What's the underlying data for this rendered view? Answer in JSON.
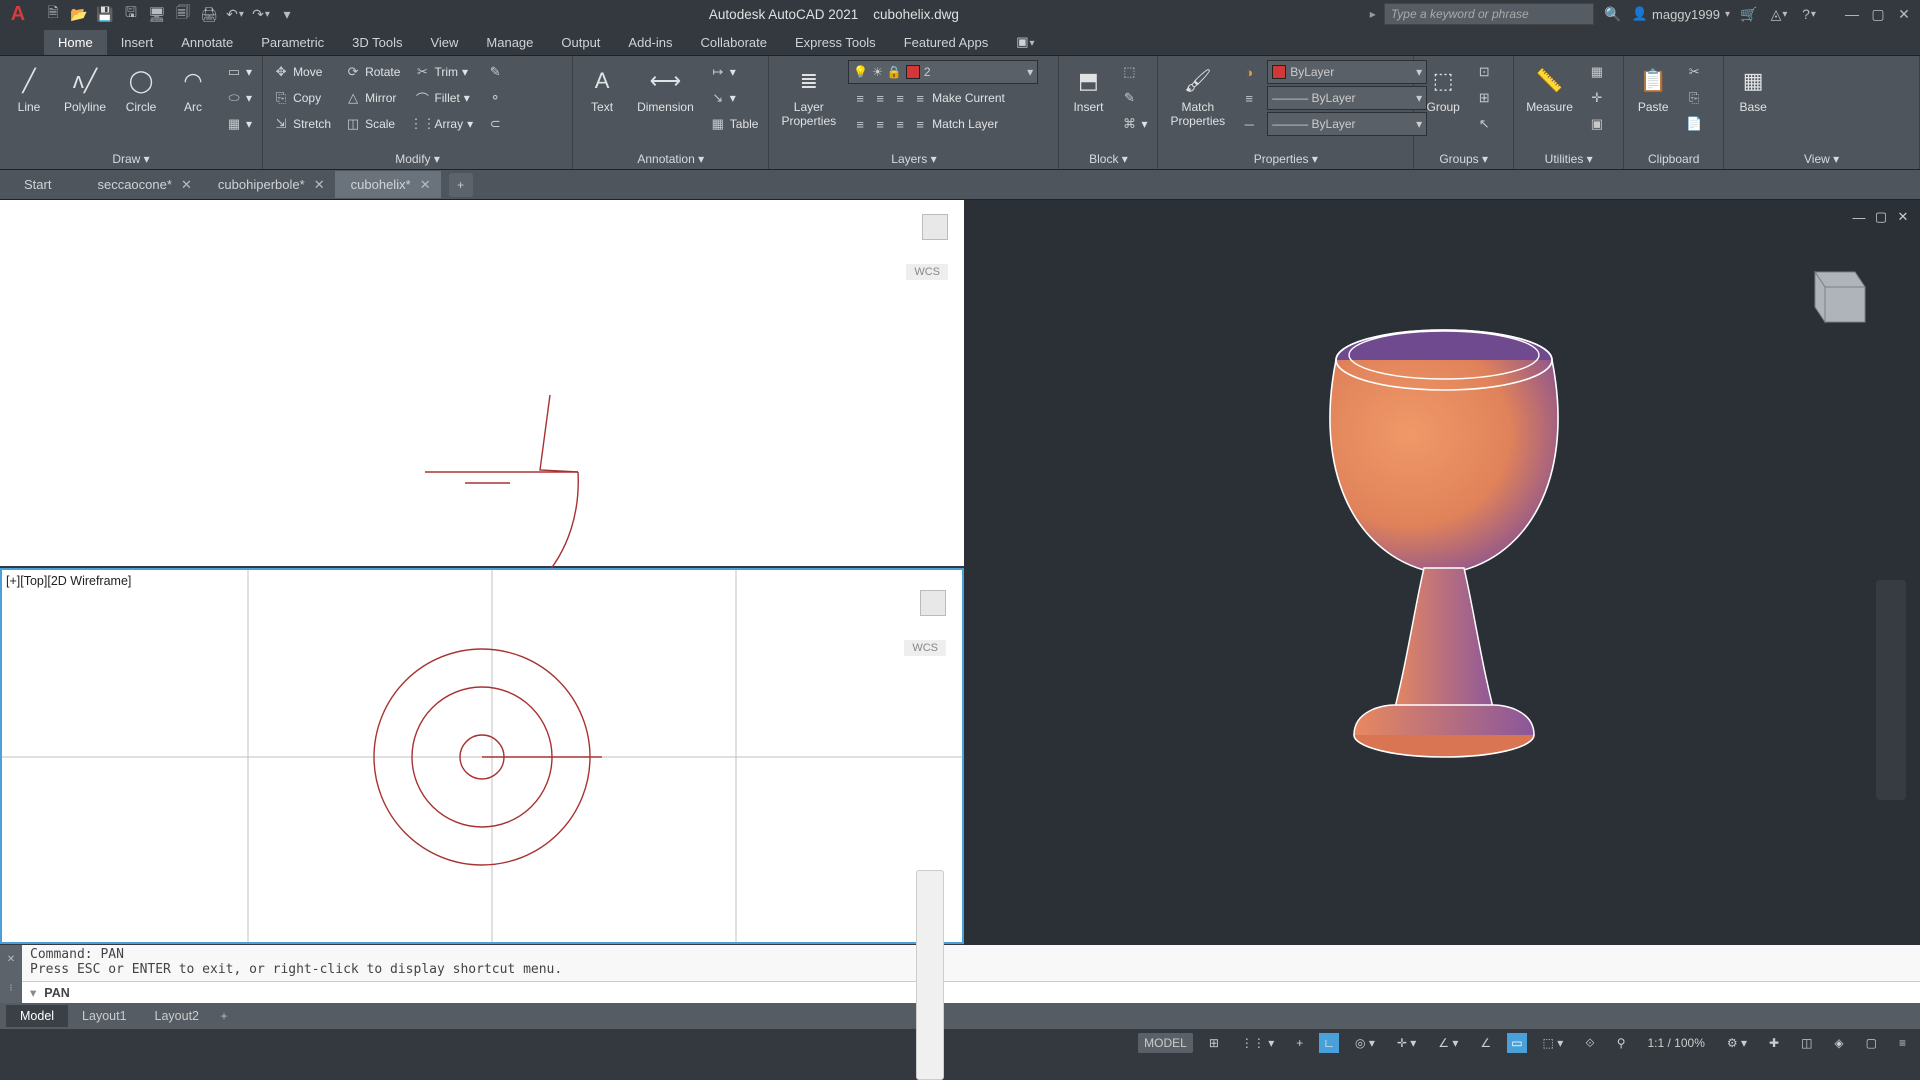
{
  "title": {
    "app": "Autodesk AutoCAD 2021",
    "file": "cubohelix.dwg"
  },
  "search_placeholder": "Type a keyword or phrase",
  "user": "maggy1999",
  "ribbon_tabs": [
    "Home",
    "Insert",
    "Annotate",
    "Parametric",
    "3D Tools",
    "View",
    "Manage",
    "Output",
    "Add-ins",
    "Collaborate",
    "Express Tools",
    "Featured Apps"
  ],
  "active_ribbon_tab": "Home",
  "panels": {
    "draw": {
      "title": "Draw ▾",
      "items": [
        "Line",
        "Polyline",
        "Circle",
        "Arc"
      ]
    },
    "modify": {
      "title": "Modify ▾",
      "row1": [
        "Move",
        "Rotate",
        "Trim"
      ],
      "row2": [
        "Copy",
        "Mirror",
        "Fillet"
      ],
      "row3": [
        "Stretch",
        "Scale",
        "Array"
      ]
    },
    "annotation": {
      "title": "Annotation ▾",
      "items": [
        "Text",
        "Dimension",
        "Table"
      ]
    },
    "layers": {
      "title": "Layers ▾",
      "btns": [
        "Make Current",
        "Match Layer"
      ],
      "lp": "Layer\nProperties",
      "current": "2"
    },
    "block": {
      "title": "Block ▾",
      "insert": "Insert"
    },
    "properties": {
      "title": "Properties ▾",
      "match": "Match\nProperties",
      "bylayer": "ByLayer"
    },
    "groups": {
      "title": "Groups ▾",
      "group": "Group"
    },
    "utilities": {
      "title": "Utilities ▾",
      "measure": "Measure"
    },
    "clipboard": {
      "title": "Clipboard",
      "paste": "Paste"
    },
    "view": {
      "title": "View ▾",
      "base": "Base"
    }
  },
  "file_tabs": [
    {
      "label": "Start",
      "closable": false,
      "active": false
    },
    {
      "label": "seccaocone*",
      "closable": true,
      "active": false
    },
    {
      "label": "cubohiperbole*",
      "closable": true,
      "active": false
    },
    {
      "label": "cubohelix*",
      "closable": true,
      "active": true
    }
  ],
  "viewport_top": {
    "wcs": "WCS"
  },
  "viewport_bottom": {
    "label": "[+][Top][2D Wireframe]",
    "wcs": "WCS"
  },
  "command": {
    "history": "Command: PAN\nPress ESC or ENTER to exit, or right-click to display shortcut menu.",
    "prompt": "PAN"
  },
  "layout_tabs": [
    "Model",
    "Layout1",
    "Layout2"
  ],
  "active_layout": "Model",
  "status_model": "MODEL",
  "status_scale": "1:1 / 100%",
  "colors": {
    "red_swatch": "#d23838",
    "accent_blue": "#4aa0d8"
  }
}
